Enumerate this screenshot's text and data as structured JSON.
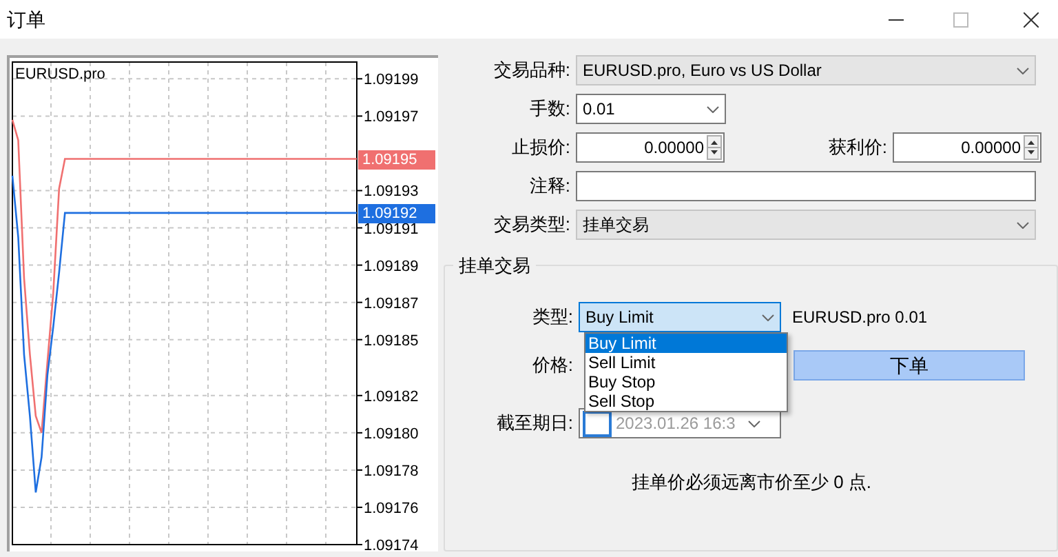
{
  "window": {
    "title": "订单"
  },
  "chart": {
    "symbol": "EURUSD.pro",
    "price_tags": [
      {
        "text": "1.09195",
        "color": "#f07070"
      },
      {
        "text": "1.09192",
        "color": "#1e6fe0"
      }
    ],
    "chart_data": {
      "type": "line",
      "grid": true,
      "categories": [
        null,
        null,
        null,
        null,
        null,
        null,
        null,
        null,
        null,
        null,
        null,
        null,
        null,
        null,
        null,
        null,
        null,
        null,
        null,
        null,
        null,
        null,
        null,
        null,
        null,
        null,
        null,
        null,
        null,
        null,
        null,
        null,
        null,
        null,
        null,
        null,
        null,
        null,
        null,
        null,
        null,
        null,
        null,
        null,
        null,
        null,
        null,
        null,
        null,
        null,
        null,
        null,
        null,
        null,
        null,
        null,
        null,
        null,
        null,
        null
      ],
      "ylim": [
        1.09174,
        1.091999
      ],
      "yticks": [
        {
          "value": 1.09199,
          "label": "1.09199"
        },
        {
          "value": 1.09197,
          "label": "1.09197"
        },
        {
          "value": 1.09193,
          "label": "1.09193"
        },
        {
          "value": 1.09191,
          "label": "1.09191"
        },
        {
          "value": 1.09189,
          "label": "1.09189"
        },
        {
          "value": 1.09187,
          "label": "1.09187"
        },
        {
          "value": 1.09185,
          "label": "1.09185"
        },
        {
          "value": 1.09182,
          "label": "1.09182"
        },
        {
          "value": 1.0918,
          "label": "1.09180"
        },
        {
          "value": 1.09178,
          "label": "1.09178"
        },
        {
          "value": 1.09176,
          "label": "1.09176"
        },
        {
          "value": 1.09174,
          "label": "1.09174"
        }
      ],
      "series": [
        {
          "color": "#f07070",
          "values": [
            1.091968,
            1.091957,
            1.091883,
            1.091842,
            1.091809,
            1.0918,
            1.091838,
            1.091875,
            1.091931,
            1.091947,
            1.091947,
            1.091947,
            1.091947,
            1.091947,
            1.091947,
            1.091947,
            1.091947,
            1.091947,
            1.091947,
            1.091947,
            1.091947,
            1.091947,
            1.091947,
            1.091947,
            1.091947,
            1.091947,
            1.091947,
            1.091947,
            1.091947,
            1.091947,
            1.091947,
            1.091947,
            1.091947,
            1.091947,
            1.091947,
            1.091947,
            1.091947,
            1.091947,
            1.091947,
            1.091947,
            1.091947,
            1.091947,
            1.091947,
            1.091947,
            1.091947,
            1.091947,
            1.091947,
            1.091947,
            1.091947,
            1.091947,
            1.091947,
            1.091947,
            1.091947,
            1.091947,
            1.091947,
            1.091947,
            1.091947,
            1.091947,
            1.091947,
            1.091947
          ]
        },
        {
          "color": "#1e6fe0",
          "values": [
            1.091938,
            1.091905,
            1.091842,
            1.091809,
            1.091768,
            1.091787,
            1.091831,
            1.091857,
            1.091886,
            1.091918,
            1.091918,
            1.091918,
            1.091918,
            1.091918,
            1.091918,
            1.091918,
            1.091918,
            1.091918,
            1.091918,
            1.091918,
            1.091918,
            1.091918,
            1.091918,
            1.091918,
            1.091918,
            1.091918,
            1.091918,
            1.091918,
            1.091918,
            1.091918,
            1.091918,
            1.091918,
            1.091918,
            1.091918,
            1.091918,
            1.091918,
            1.091918,
            1.091918,
            1.091918,
            1.091918,
            1.091918,
            1.091918,
            1.091918,
            1.091918,
            1.091918,
            1.091918,
            1.091918,
            1.091918,
            1.091918,
            1.091918,
            1.091918,
            1.091918,
            1.091918,
            1.091918,
            1.091918,
            1.091918,
            1.091918,
            1.091918,
            1.091918,
            1.091918
          ]
        }
      ]
    }
  },
  "symbol": {
    "label": "交易品种:",
    "value": "EURUSD.pro, Euro vs US Dollar"
  },
  "volume": {
    "label": "手数:",
    "value": "0.01"
  },
  "stop_loss": {
    "label": "止损价:",
    "value": "0.00000"
  },
  "take_profit": {
    "label": "获利价:",
    "value": "0.00000"
  },
  "comment": {
    "label": "注释:"
  },
  "order_type": {
    "label": "交易类型:",
    "value": "挂单交易"
  },
  "pending": {
    "title": "挂单交易",
    "type": {
      "label": "类型:",
      "value": "Buy Limit",
      "expanded": true,
      "options": [
        {
          "label": "Buy Limit",
          "selected": true
        },
        {
          "label": "Sell Limit",
          "selected": false
        },
        {
          "label": "Buy Stop",
          "selected": false
        },
        {
          "label": "Sell Stop",
          "selected": false
        }
      ]
    },
    "type_info": "EURUSD.pro 0.01",
    "price": {
      "label": "价格:"
    },
    "place_button": "下单",
    "expiry": {
      "label": "截至期日:",
      "checked": false,
      "value": "2023.01.26 16:3",
      "disabled": true
    },
    "note": "挂单价必须远离市价至少 0 点."
  }
}
